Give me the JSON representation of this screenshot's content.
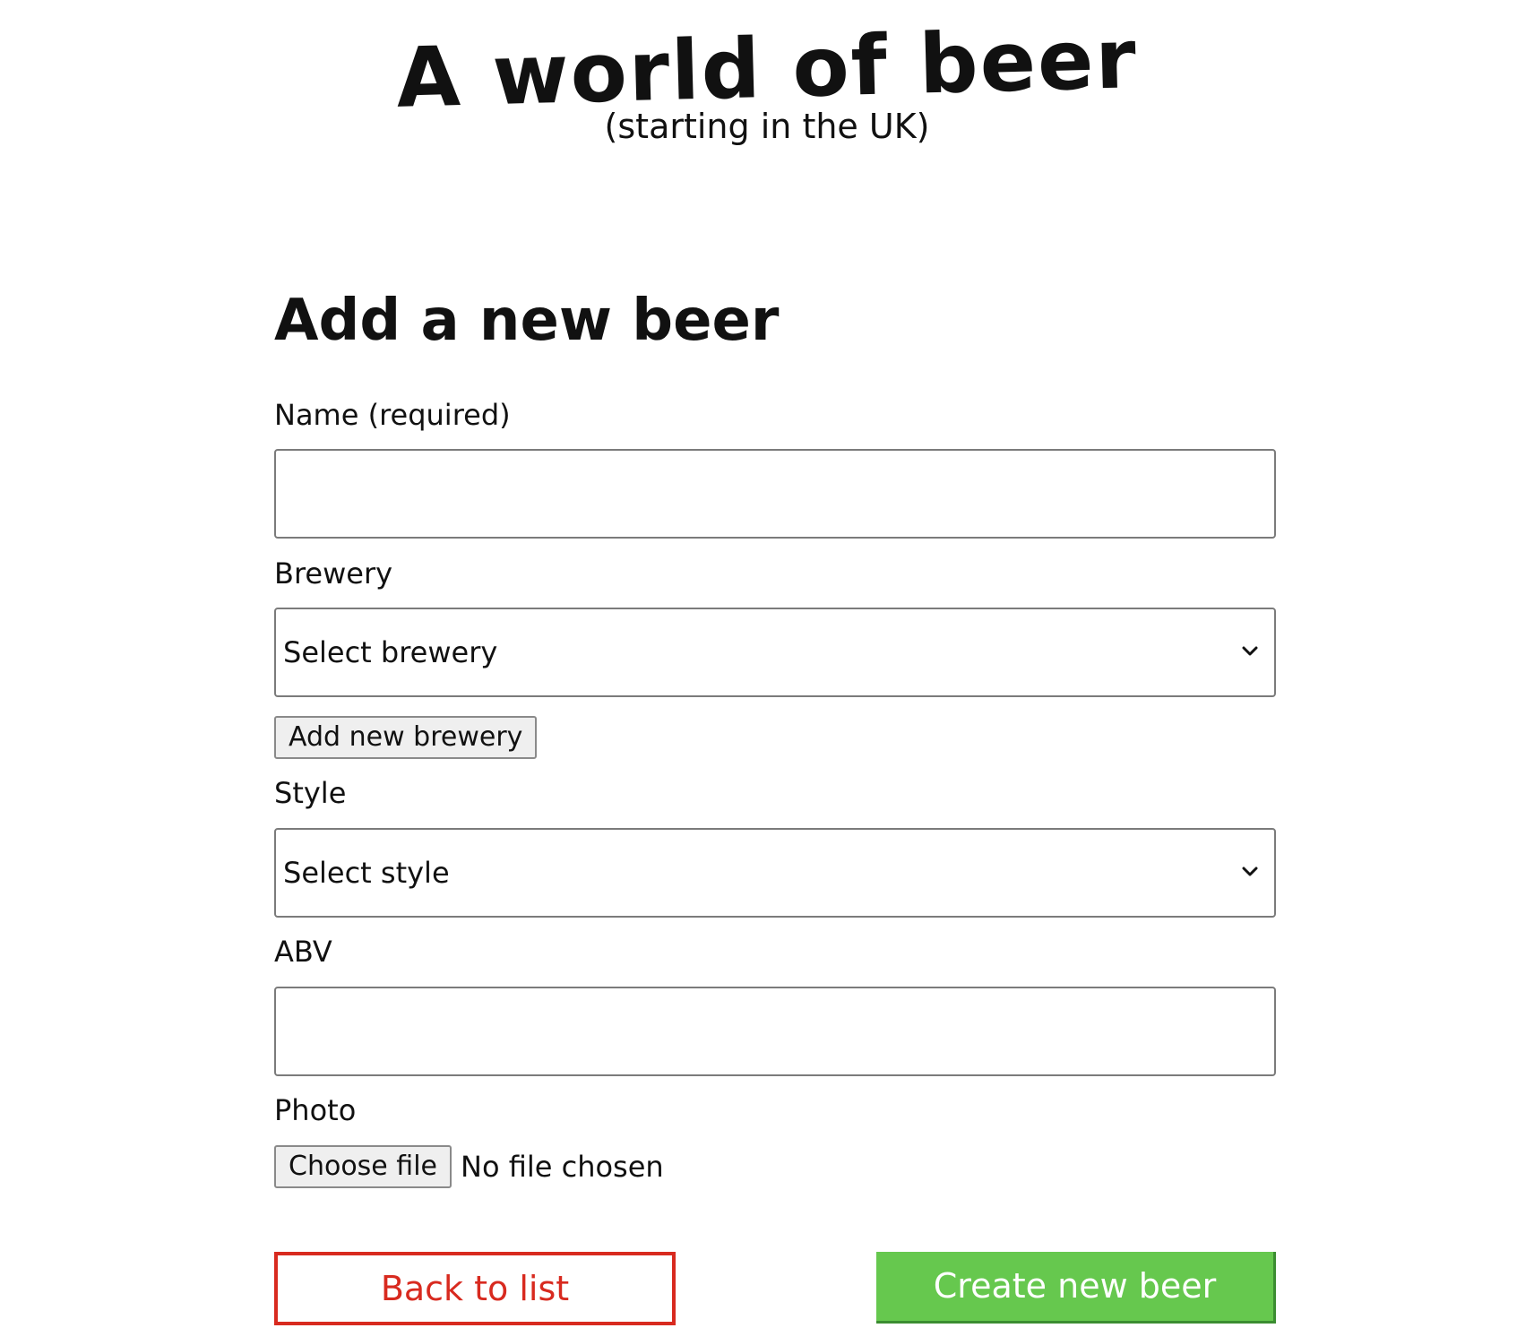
{
  "header": {
    "title": "A world of beer",
    "subtitle": "(starting in the UK)"
  },
  "form": {
    "title": "Add a new beer",
    "name": {
      "label": "Name (required)",
      "value": ""
    },
    "brewery": {
      "label": "Brewery",
      "selected": "Select brewery",
      "add_button_label": "Add new brewery"
    },
    "style": {
      "label": "Style",
      "selected": "Select style"
    },
    "abv": {
      "label": "ABV",
      "value": ""
    },
    "photo": {
      "label": "Photo",
      "button_label": "Choose file",
      "status": "No file chosen"
    },
    "actions": {
      "back_label": "Back to list",
      "create_label": "Create new beer"
    }
  },
  "colors": {
    "back_button": "#d82a1f",
    "create_button": "#66c84e"
  }
}
